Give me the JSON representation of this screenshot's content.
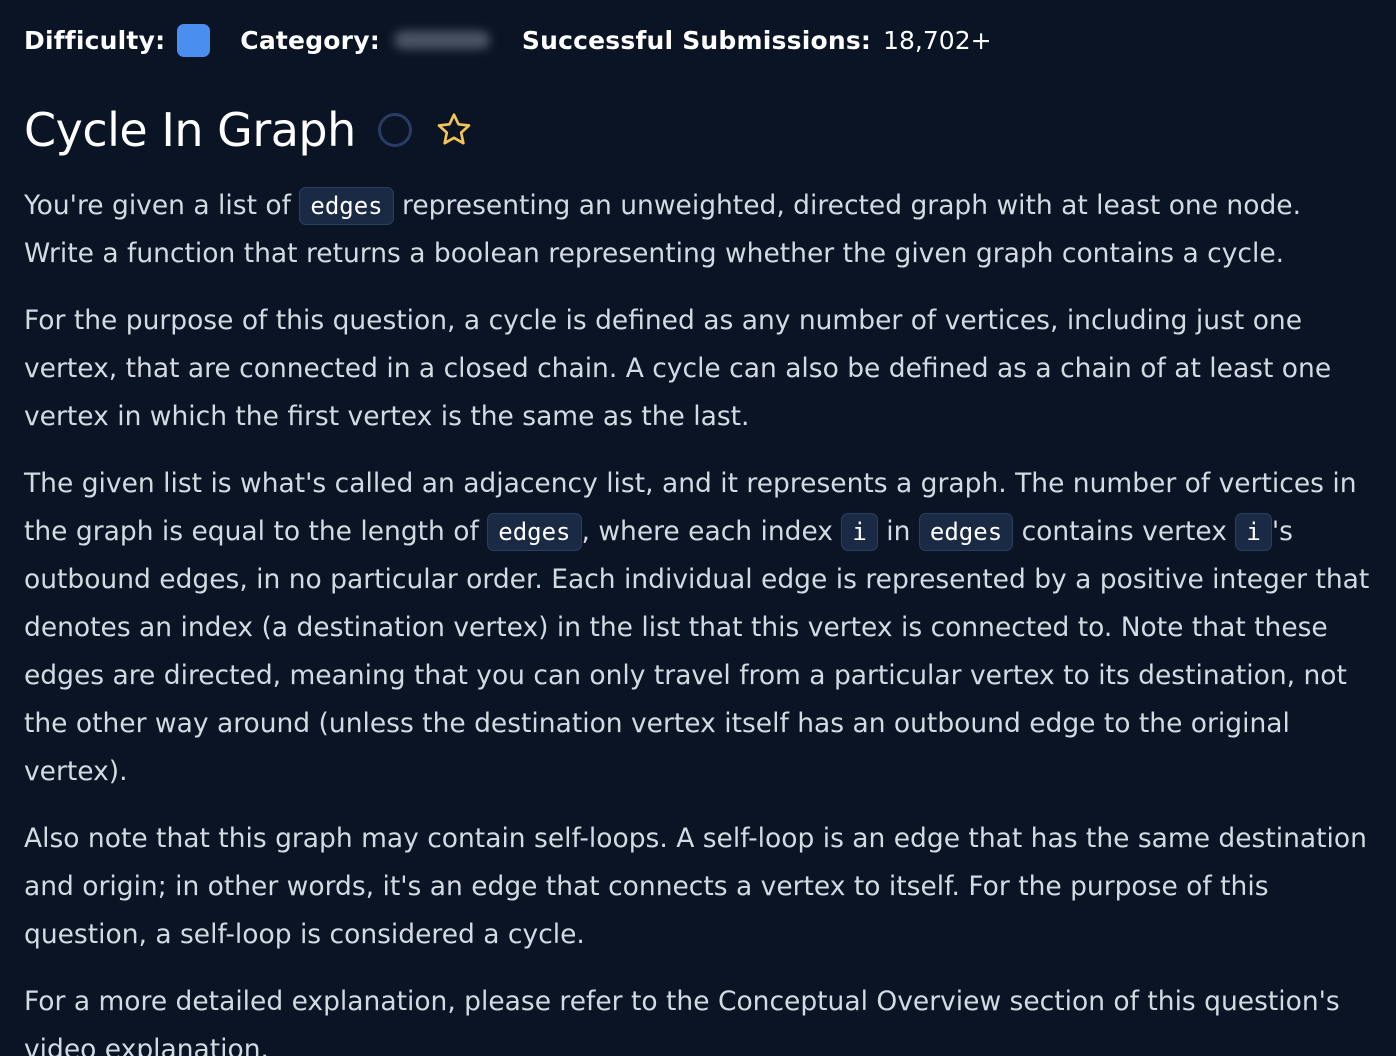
{
  "meta": {
    "difficulty_label": "Difficulty:",
    "difficulty_color": "#4a8ff0",
    "category_label": "Category:",
    "submissions_label": "Successful Submissions:",
    "submissions_value": "18,702+"
  },
  "question": {
    "title": "Cycle In Graph",
    "status_icon": "circle-outline-icon",
    "favorite_icon": "star-outline-icon"
  },
  "description": {
    "p1": {
      "t1": "You're given a list of ",
      "c1": "edges",
      "t2": " representing an unweighted, directed graph with at least one node. Write a function that returns a boolean representing whether the given graph contains a cycle."
    },
    "p2": "For the purpose of this question, a cycle is defined as any number of vertices, including just one vertex, that are connected in a closed chain. A cycle can also be defined as a chain of at least one vertex in which the first vertex is the same as the last.",
    "p3": {
      "t1": "The given list is what's called an adjacency list, and it represents a graph. The number of vertices in the graph is equal to the length of ",
      "c1": "edges",
      "t2": ", where each index ",
      "c2": "i",
      "t3": " in ",
      "c3": "edges",
      "t4": " contains vertex ",
      "c4": "i",
      "t5": "'s outbound edges, in no particular order. Each individual edge is represented by a positive integer that denotes an index (a destination vertex) in the list that this vertex is connected to. Note that these edges are directed, meaning that you can only travel from a particular vertex to its destination, not the other way around (unless the destination vertex itself has an outbound edge to the original vertex)."
    },
    "p4": "Also note that this graph may contain self-loops. A self-loop is an edge that has the same destination and origin; in other words, it's an edge that connects a vertex to itself. For the purpose of this question, a self-loop is considered a cycle.",
    "p5": "For a more detailed explanation, please refer to the Conceptual Overview section of this question's video explanation."
  }
}
